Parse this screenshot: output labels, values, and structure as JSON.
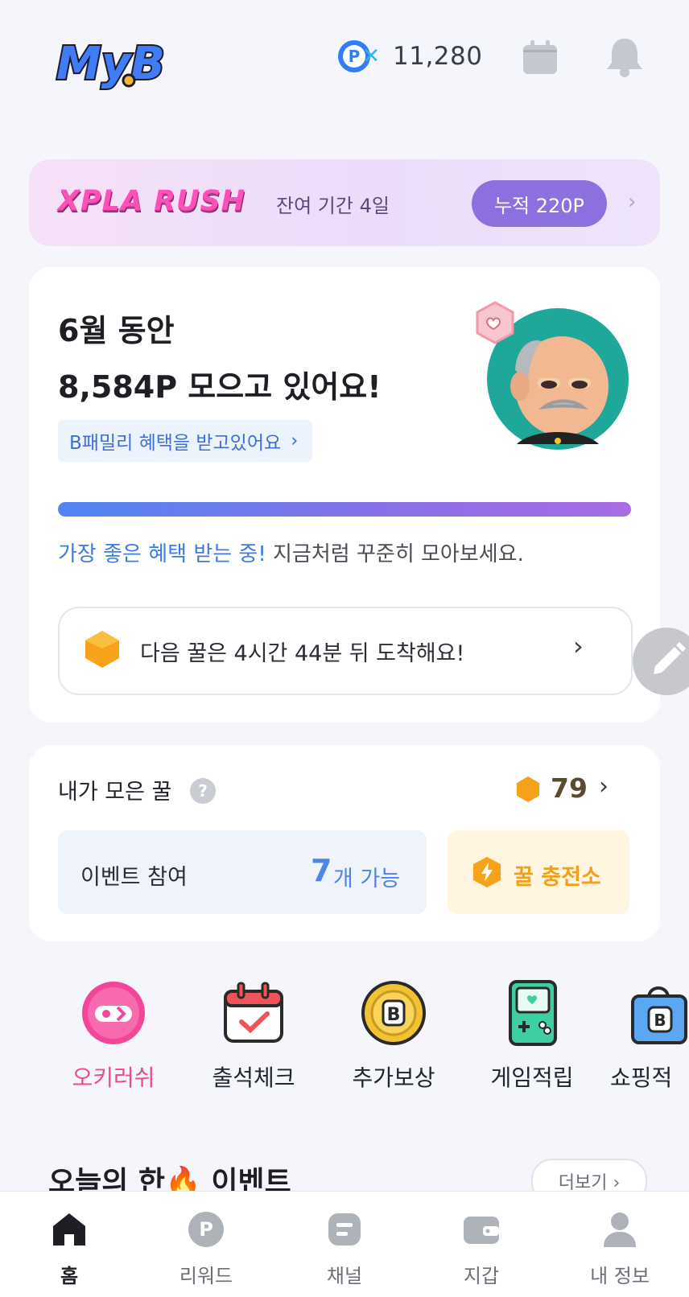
{
  "header": {
    "logo_text": "MyB",
    "points_value": "11,280",
    "points_coin_letter": "P"
  },
  "banner": {
    "title": "XPLA RUSH",
    "remaining": "잔여 기간 4일",
    "accumulated": "누적 220P",
    "chevron": "›"
  },
  "summary": {
    "line1": "6월 동안",
    "line2": "8,584P 모으고 있어요!",
    "family_badge": "B패밀리 혜택을 받고있어요",
    "family_chevron": "›",
    "progress": 1.0,
    "status_highlight": "가장 좋은 혜택 받는 중!",
    "status_rest": " 지금처럼 꾸준히 모아보세요.",
    "next_honey": "다음 꿀은 4시간 44분 뒤 도착해요!",
    "next_chevron": "›"
  },
  "honey": {
    "title": "내가 모은 꿀",
    "help": "?",
    "count": "79",
    "chevron": "›",
    "event_label": "이벤트 참여",
    "event_count": "7",
    "event_unit": "개 가능",
    "charge_label": "꿀 충전소"
  },
  "shortcuts": [
    {
      "label": "오키러쉬",
      "icon": "okirush-icon"
    },
    {
      "label": "출석체크",
      "icon": "calendar-check-icon"
    },
    {
      "label": "추가보상",
      "icon": "b-coin-icon"
    },
    {
      "label": "게임적립",
      "icon": "game-console-icon"
    },
    {
      "label": "쇼핑적",
      "icon": "shopping-bag-icon"
    }
  ],
  "today_event": {
    "title": "오늘의 한🔥 이벤트",
    "more": "더보기 ›"
  },
  "nav": [
    {
      "label": "홈",
      "icon": "home-icon",
      "active": true
    },
    {
      "label": "리워드",
      "icon": "reward-icon",
      "active": false
    },
    {
      "label": "채널",
      "icon": "channel-icon",
      "active": false
    },
    {
      "label": "지갑",
      "icon": "wallet-icon",
      "active": false
    },
    {
      "label": "내 정보",
      "icon": "profile-icon",
      "active": false
    }
  ],
  "colors": {
    "accent_blue": "#3d7be0",
    "pill_purple": "#8d6fe0",
    "honey_orange": "#f7a21b",
    "okirush_pink": "#ef4a8e"
  }
}
